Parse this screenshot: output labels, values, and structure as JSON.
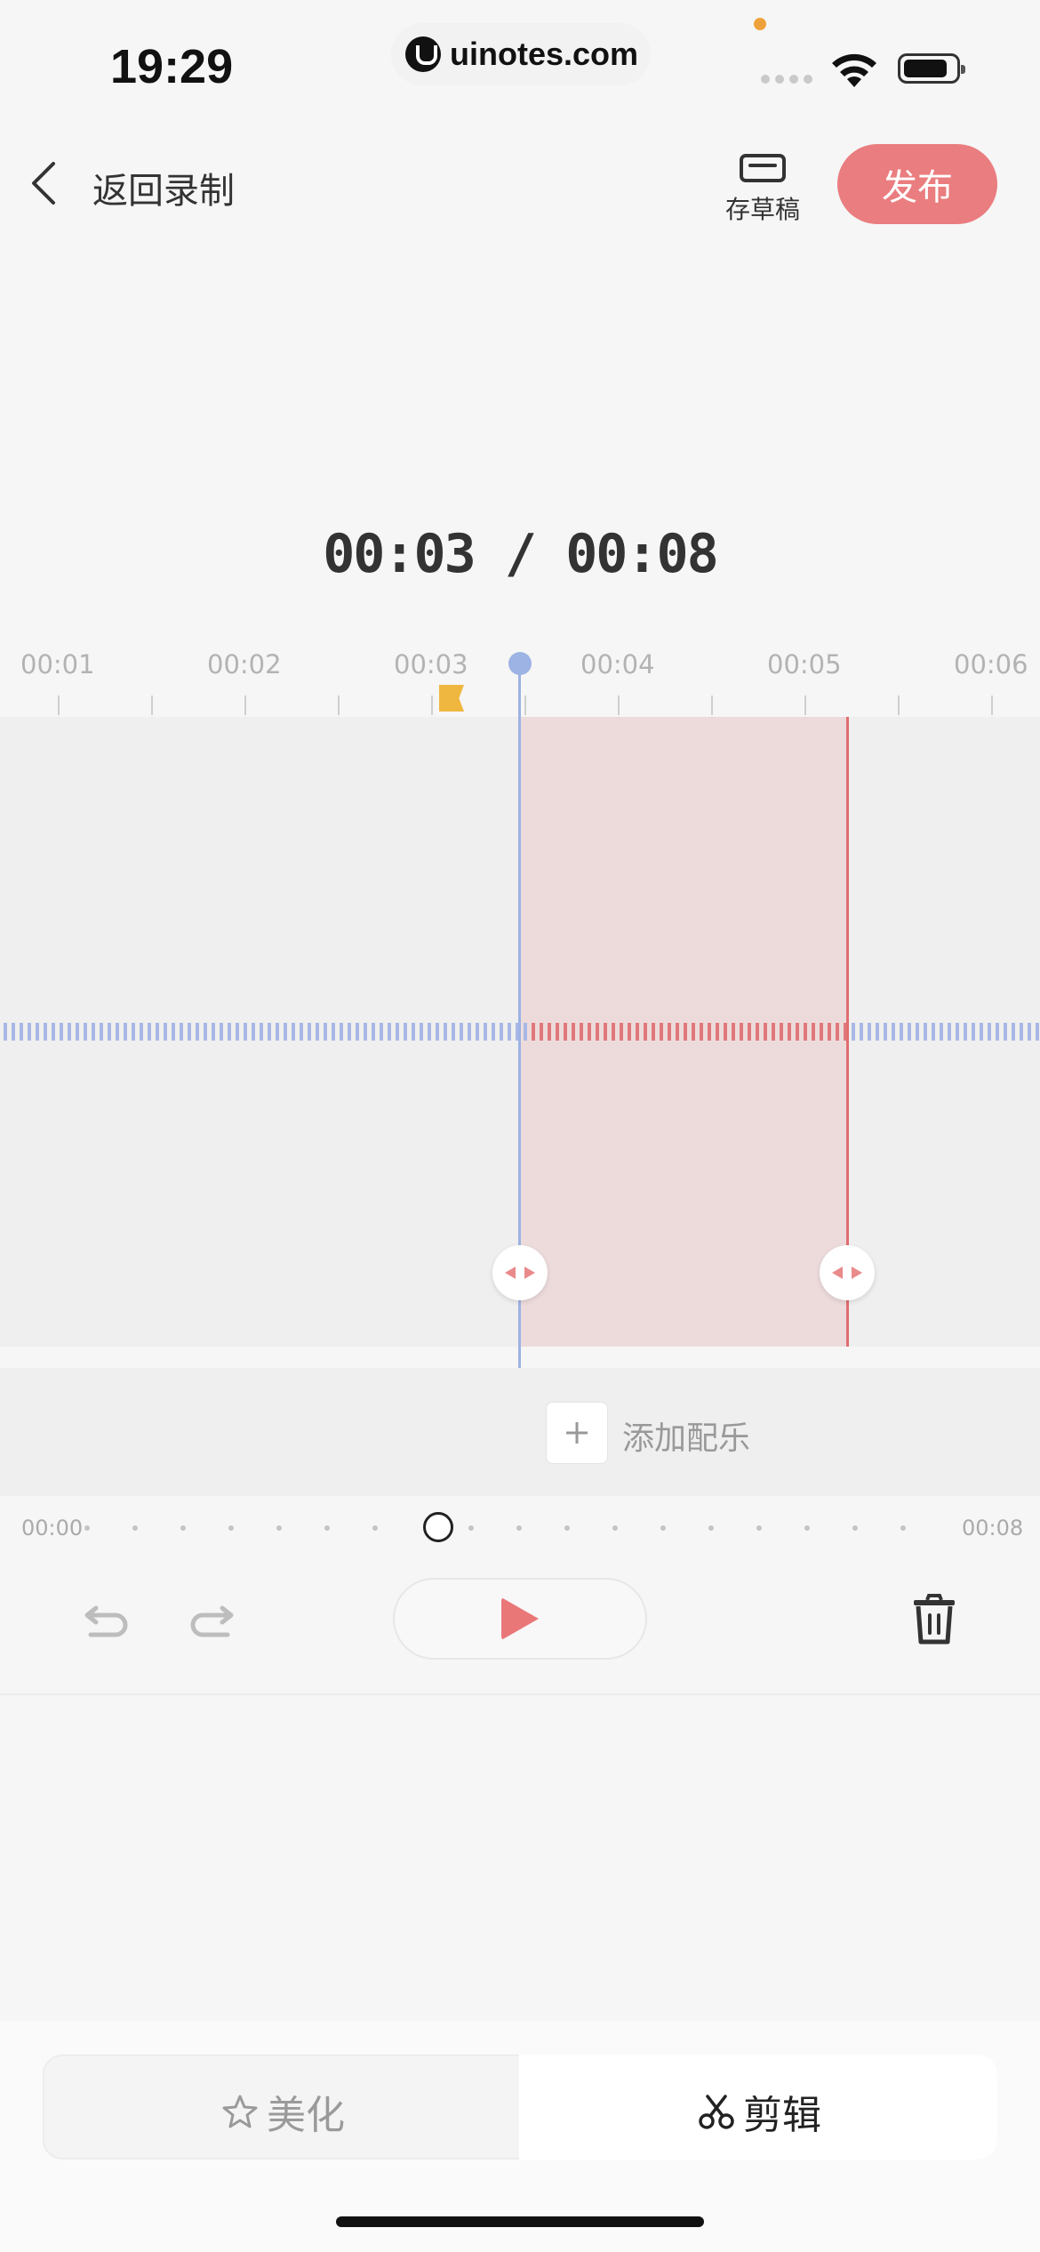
{
  "status": {
    "time": "19:29",
    "url": "uinotes.com"
  },
  "nav": {
    "back_label": "返回录制",
    "draft_label": "存草稿",
    "publish_label": "发布"
  },
  "player": {
    "current_time": "00:03",
    "total_time": "00:08",
    "separator": " / "
  },
  "ruler": {
    "labels": [
      "00:01",
      "00:02",
      "00:03",
      "00:04",
      "00:05",
      "00:06"
    ]
  },
  "selection": {
    "start_sec": 3.5,
    "end_sec": 5.25
  },
  "music": {
    "add_label": "添加配乐"
  },
  "progress": {
    "start": "00:00",
    "end": "00:08",
    "position_sec": 3.5
  },
  "tabs": {
    "beauty_label": "美化",
    "edit_label": "剪辑",
    "active": "edit"
  },
  "colors": {
    "accent": "#ea7d7f",
    "playhead": "#9db3e4",
    "waveform_inactive": "#a8b8e6",
    "waveform_selected": "#e0787a",
    "marker": "#f0b740"
  },
  "icons": {
    "back": "chevron-left-icon",
    "draft": "draft-icon",
    "play": "play-icon",
    "undo": "undo-icon",
    "redo": "redo-icon",
    "trash": "trash-icon",
    "beauty": "star-sparkle-icon",
    "edit": "scissors-icon"
  }
}
